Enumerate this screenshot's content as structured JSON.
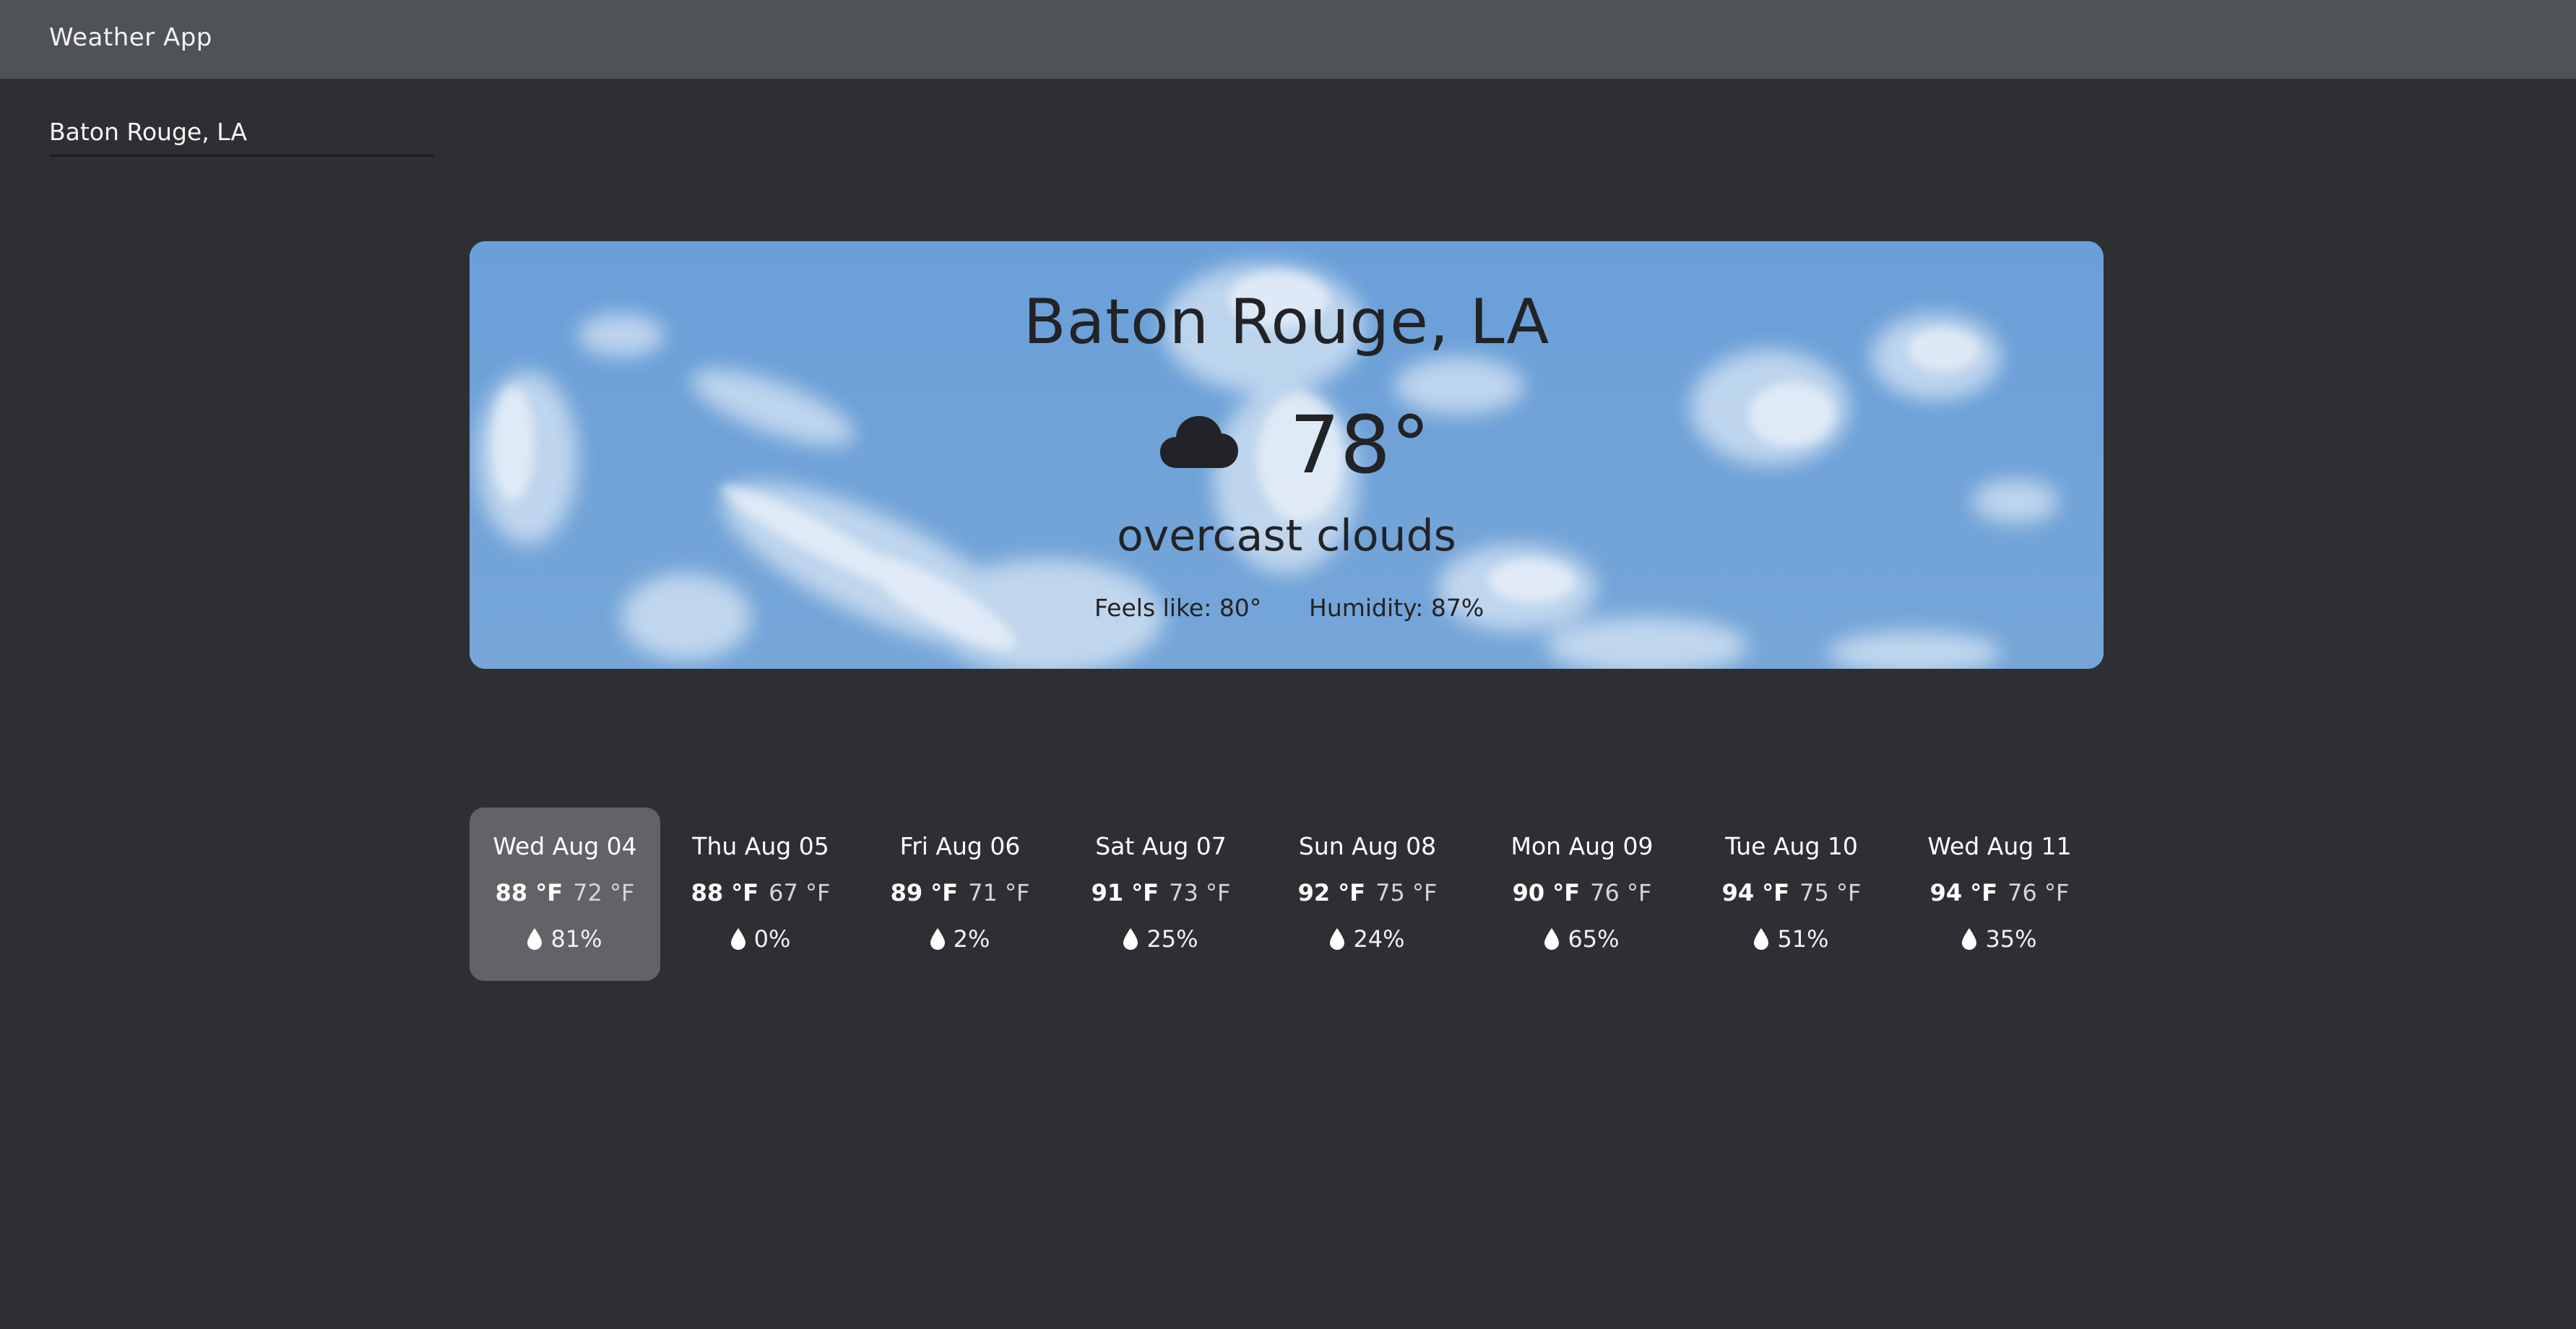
{
  "header": {
    "app_title": "Weather App"
  },
  "search": {
    "value": "Baton Rouge, LA",
    "placeholder": ""
  },
  "current": {
    "city": "Baton Rouge, LA",
    "icon": "cloud-icon",
    "temperature": "78°",
    "description": "overcast clouds",
    "feels_like": "Feels like: 80°",
    "humidity": "Humidity: 87%"
  },
  "forecast": [
    {
      "date": "Wed Aug 04",
      "high": "88 °F",
      "low": "72 °F",
      "precip": "81%",
      "selected": true
    },
    {
      "date": "Thu Aug 05",
      "high": "88 °F",
      "low": "67 °F",
      "precip": "0%",
      "selected": false
    },
    {
      "date": "Fri Aug 06",
      "high": "89 °F",
      "low": "71 °F",
      "precip": "2%",
      "selected": false
    },
    {
      "date": "Sat Aug 07",
      "high": "91 °F",
      "low": "73 °F",
      "precip": "25%",
      "selected": false
    },
    {
      "date": "Sun Aug 08",
      "high": "92 °F",
      "low": "75 °F",
      "precip": "24%",
      "selected": false
    },
    {
      "date": "Mon Aug 09",
      "high": "90 °F",
      "low": "76 °F",
      "precip": "65%",
      "selected": false
    },
    {
      "date": "Tue Aug 10",
      "high": "94 °F",
      "low": "75 °F",
      "precip": "51%",
      "selected": false
    },
    {
      "date": "Wed Aug 11",
      "high": "94 °F",
      "low": "76 °F",
      "precip": "35%",
      "selected": false
    }
  ],
  "colors": {
    "background": "#2e2f33",
    "navbar": "#4f5257",
    "card_sky": "#6d9fd5",
    "selected_day": "#626366",
    "card_text": "#222326"
  }
}
